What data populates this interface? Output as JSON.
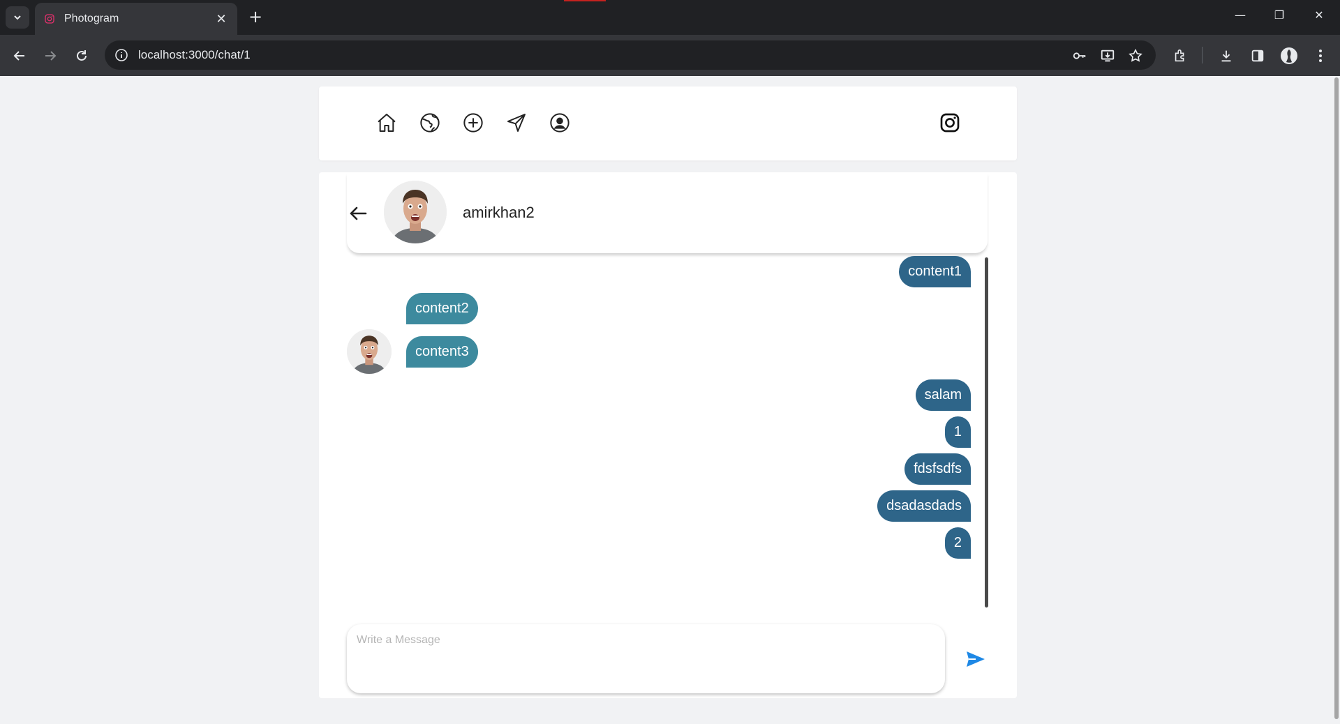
{
  "browser": {
    "tab_title": "Photogram",
    "tab_close": "✕",
    "new_tab": "+",
    "url": "localhost:3000/chat/1",
    "window_minimize": "—",
    "window_restore": "❐",
    "window_close": "✕"
  },
  "nav": {
    "icons": [
      "home-icon",
      "globe-icon",
      "add-circle-icon",
      "send-nav-icon",
      "profile-icon"
    ],
    "brand_icon": "instagram-icon"
  },
  "chat": {
    "username": "amirkhan2",
    "messages": [
      {
        "side": "me",
        "text": "content1"
      },
      {
        "side": "other",
        "text": "content2"
      },
      {
        "side": "other",
        "text": "content3",
        "avatar": true
      },
      {
        "side": "me",
        "text": "salam"
      },
      {
        "side": "me",
        "text": "1"
      },
      {
        "side": "me",
        "text": "fdsfsdfs"
      },
      {
        "side": "me",
        "text": "dsadasdads"
      },
      {
        "side": "me",
        "text": "2"
      }
    ],
    "composer_placeholder": "Write a Message",
    "composer_value": ""
  },
  "colors": {
    "my_bubble": "#2e6589",
    "other_bubble": "#3d8a9e",
    "send_accent": "#1e88e5"
  }
}
